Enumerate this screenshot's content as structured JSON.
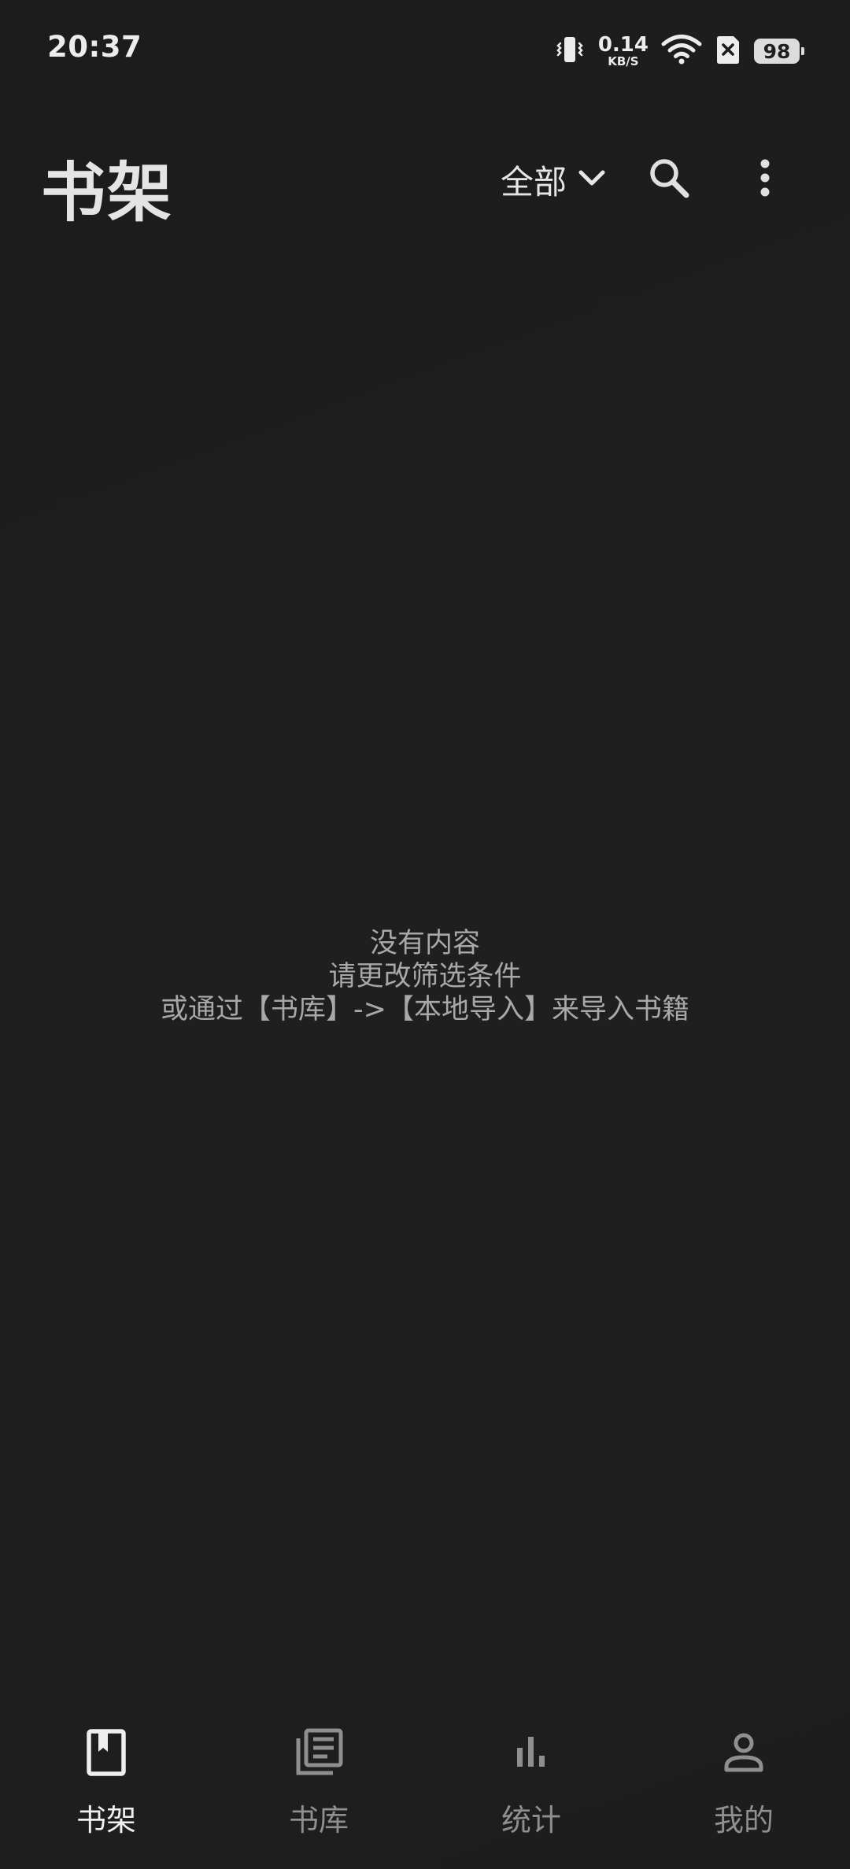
{
  "status_bar": {
    "time": "20:37",
    "net_speed_value": "0.14",
    "net_speed_unit": "KB/S",
    "battery_level": "98",
    "icons": [
      "vibrate-icon",
      "wifi-icon",
      "sim-off-icon",
      "battery-icon"
    ]
  },
  "header": {
    "title": "书架",
    "filter_label": "全部",
    "icons": [
      "chevron-down-icon",
      "search-icon",
      "more-vert-icon"
    ]
  },
  "empty_state": {
    "line1": "没有内容",
    "line2": "请更改筛选条件",
    "line3": "或通过【书库】->【本地导入】来导入书籍"
  },
  "bottom_nav": {
    "items": [
      {
        "label": "书架",
        "icon": "bookshelf-icon",
        "active": true
      },
      {
        "label": "书库",
        "icon": "library-icon",
        "active": false
      },
      {
        "label": "统计",
        "icon": "bar-chart-icon",
        "active": false
      },
      {
        "label": "我的",
        "icon": "person-icon",
        "active": false
      }
    ]
  },
  "colors": {
    "background": "#1e1e1e",
    "text_primary": "#e6e6e6",
    "text_secondary": "#a8a8a8",
    "nav_inactive": "#8f8f8f"
  }
}
